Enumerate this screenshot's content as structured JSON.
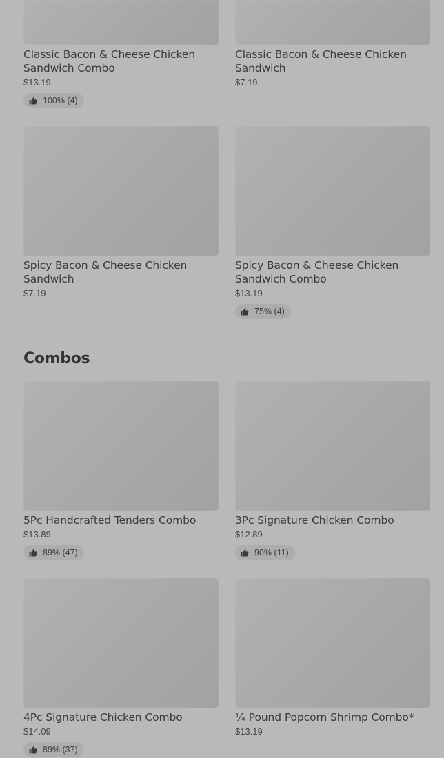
{
  "top_items": [
    {
      "title": "Classic Bacon & Cheese Chicken Sandwich Combo",
      "price": "$13.19",
      "rating": "100% (4)"
    },
    {
      "title": "Classic Bacon & Cheese Chicken Sandwich",
      "price": "$7.19"
    },
    {
      "title": "Spicy Bacon & Cheese Chicken Sandwich",
      "price": "$7.19"
    },
    {
      "title": "Spicy Bacon & Cheese Chicken Sandwich Combo",
      "price": "$13.19",
      "rating": "75% (4)"
    }
  ],
  "combos": {
    "title": "Combos",
    "items": [
      {
        "title": "5Pc Handcrafted Tenders Combo",
        "price": "$13.89",
        "rating": "89% (47)"
      },
      {
        "title": "3Pc Signature Chicken Combo",
        "price": "$12.89",
        "rating": "90% (11)"
      },
      {
        "title": "4Pc Signature Chicken Combo",
        "price": "$14.09",
        "rating": "89% (37)"
      },
      {
        "title": "¼ Pound Popcorn Shrimp Combo*",
        "price": "$13.19"
      }
    ]
  },
  "icons": {
    "rating": "thumbs-up-icon"
  },
  "colors": {
    "background": "#b9b9b9",
    "image_placeholder": "#ababab",
    "rating_pill": "#adadad",
    "text": "#3b3b3b"
  }
}
